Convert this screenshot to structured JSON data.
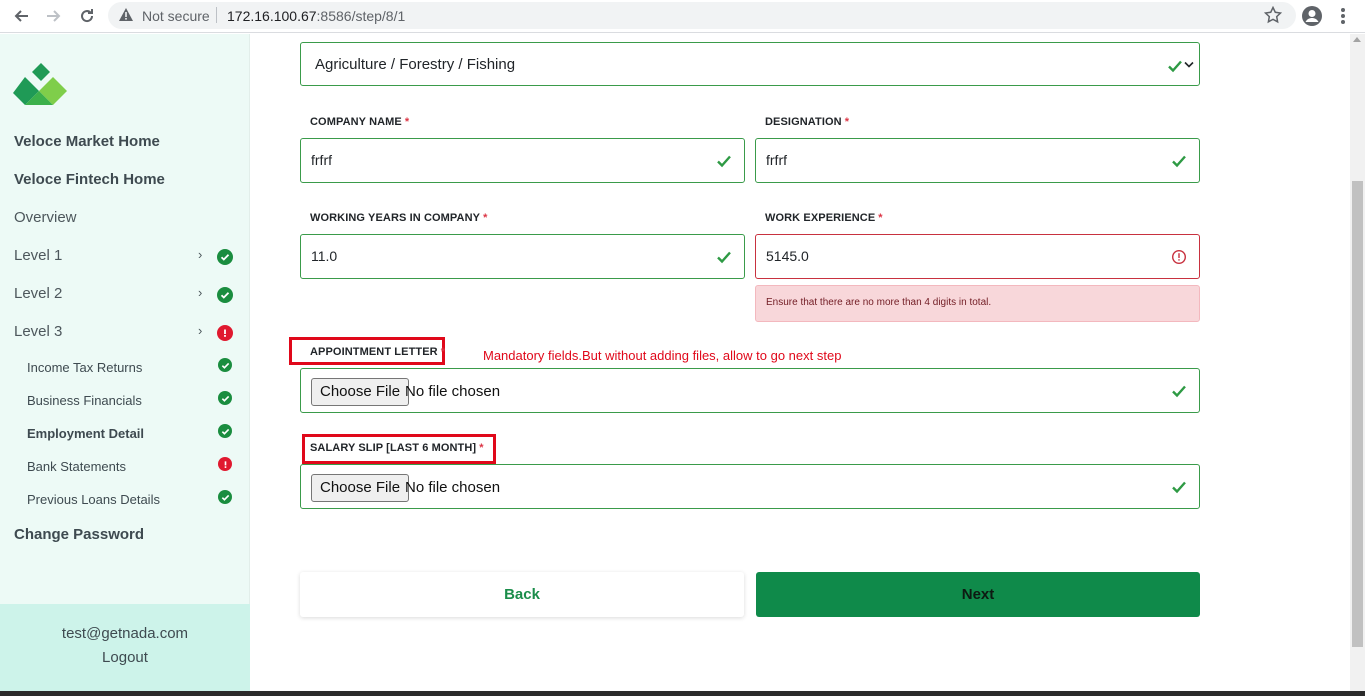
{
  "browser": {
    "security_status": "Not secure",
    "url_host": "172.16.100.67",
    "url_rest": ":8586/step/8/1"
  },
  "sidebar": {
    "nav": [
      {
        "label": "Veloce Market Home"
      },
      {
        "label": "Veloce Fintech Home"
      },
      {
        "label": "Overview"
      },
      {
        "label": "Level 1",
        "status": "complete"
      },
      {
        "label": "Level 2",
        "status": "complete"
      },
      {
        "label": "Level 3",
        "status": "error"
      }
    ],
    "sub_items": [
      {
        "label": "Income Tax Returns",
        "status": "complete"
      },
      {
        "label": "Business Financials",
        "status": "complete"
      },
      {
        "label": "Employment Detail",
        "status": "complete"
      },
      {
        "label": "Bank Statements",
        "status": "error"
      },
      {
        "label": "Previous Loans Details",
        "status": "complete"
      }
    ],
    "change_password": "Change Password",
    "user_email": "test@getnada.com",
    "logout": "Logout"
  },
  "form": {
    "industry_value": "Agriculture / Forestry / Fishing",
    "company_name": {
      "label": "COMPANY NAME",
      "value": "frfrf"
    },
    "designation": {
      "label": "DESIGNATION",
      "value": "frfrf"
    },
    "working_years": {
      "label": "WORKING YEARS IN COMPANY",
      "value": "11.0"
    },
    "work_experience": {
      "label": "WORK EXPERIENCE",
      "value": "5145.0",
      "error": "Ensure that there are no more than 4 digits in total."
    },
    "appointment_letter": {
      "label": "APPOINTMENT LETTER",
      "button": "Choose File",
      "status": "No file chosen"
    },
    "salary_slip": {
      "label": "SALARY SLIP [LAST 6 MONTH]",
      "button": "Choose File",
      "status": "No file chosen"
    },
    "required_marker": "*",
    "back_label": "Back",
    "next_label": "Next"
  },
  "annotation": "Mandatory fields.But without adding files, allow to go next step",
  "colors": {
    "valid": "#3a9b4a",
    "invalid": "#c8313f",
    "primary": "#0f8a4a",
    "sidebar_bg": "#edfaf6",
    "annotation": "#e0081a"
  }
}
